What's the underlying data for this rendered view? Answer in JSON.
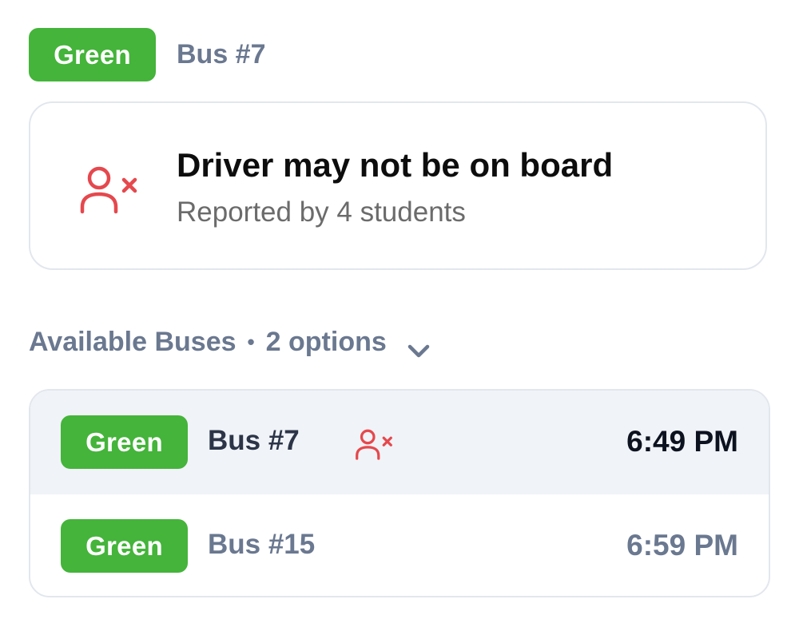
{
  "current": {
    "line_badge": "Green",
    "bus_label": "Bus #7"
  },
  "alert": {
    "icon": "user-x-icon",
    "title": "Driver may not be on board",
    "subtitle": "Reported by 4 students"
  },
  "available": {
    "title": "Available Buses",
    "separator": "•",
    "count_label": "2 options",
    "toggle_icon": "chevron-down-icon",
    "buses": [
      {
        "line_badge": "Green",
        "bus_label": "Bus #7",
        "time": "6:49 PM",
        "warning_icon": "user-x-icon",
        "selected": true
      },
      {
        "line_badge": "Green",
        "bus_label": "Bus #15",
        "time": "6:59 PM",
        "selected": false
      }
    ]
  },
  "colors": {
    "badge_green": "#44b43a",
    "alert_red": "#e5484d",
    "muted_slate": "#6a7890",
    "selected_row_bg": "#f0f3f7"
  }
}
